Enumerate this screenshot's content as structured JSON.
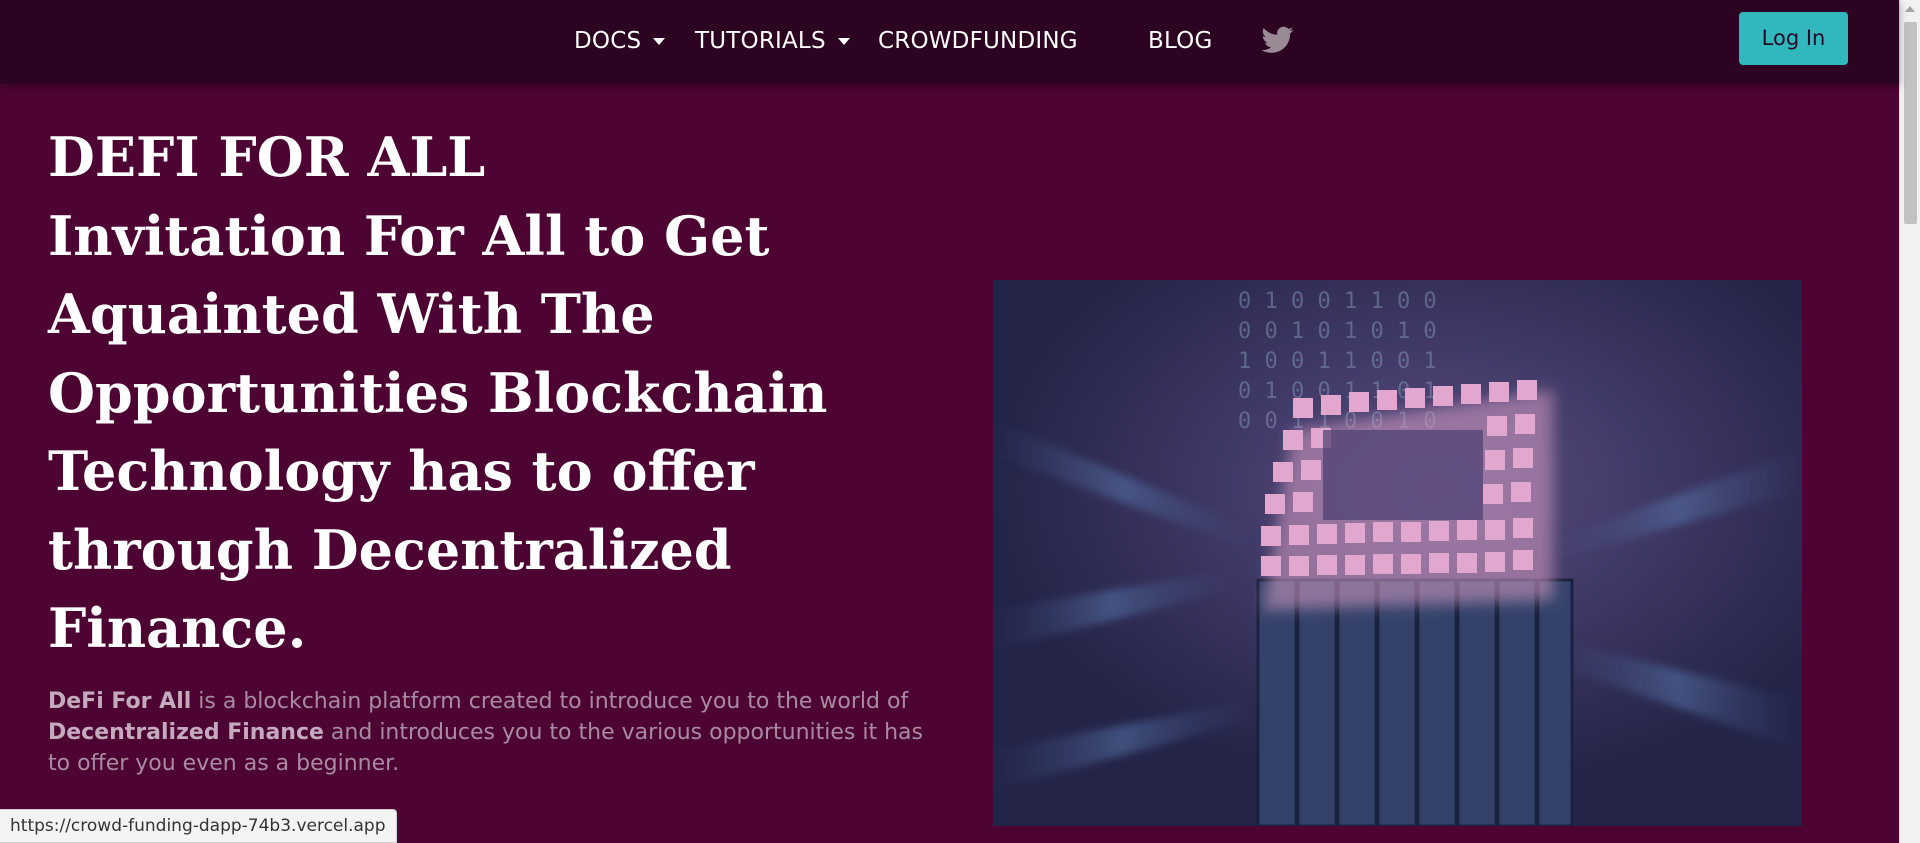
{
  "nav": {
    "items": [
      {
        "label": "DOCS",
        "dropdown": true
      },
      {
        "label": "TUTORIALS",
        "dropdown": true
      },
      {
        "label": "CROWDFUNDING",
        "dropdown": false
      },
      {
        "label": "BLOG",
        "dropdown": false
      }
    ],
    "social_icon": "twitter-icon",
    "login_label": "Log In"
  },
  "hero": {
    "title_line1": "DEFI FOR ALL",
    "title_lines": [
      "Invitation For All to Get",
      "Aquainted With The",
      "Opportunities Blockchain",
      "Technology has to offer",
      "through Decentralized",
      "Finance."
    ],
    "description": {
      "brand": "DeFi For All",
      "text1": " is a blockchain platform created to introduce you to the world of ",
      "highlight": "Decentralized Finance",
      "text2": " and introduces you to the various opportunities it has to offer you even as a beginner."
    },
    "image_icon": "blockchain-cube-illustration"
  },
  "status_bar": {
    "url": "https://crowd-funding-dapp-74b3.vercel.app"
  },
  "colors": {
    "page_background": "#4e0433",
    "navbar_background": "#2c0320",
    "login_button": "#30b8bd",
    "description_text": "#a98ba1"
  }
}
